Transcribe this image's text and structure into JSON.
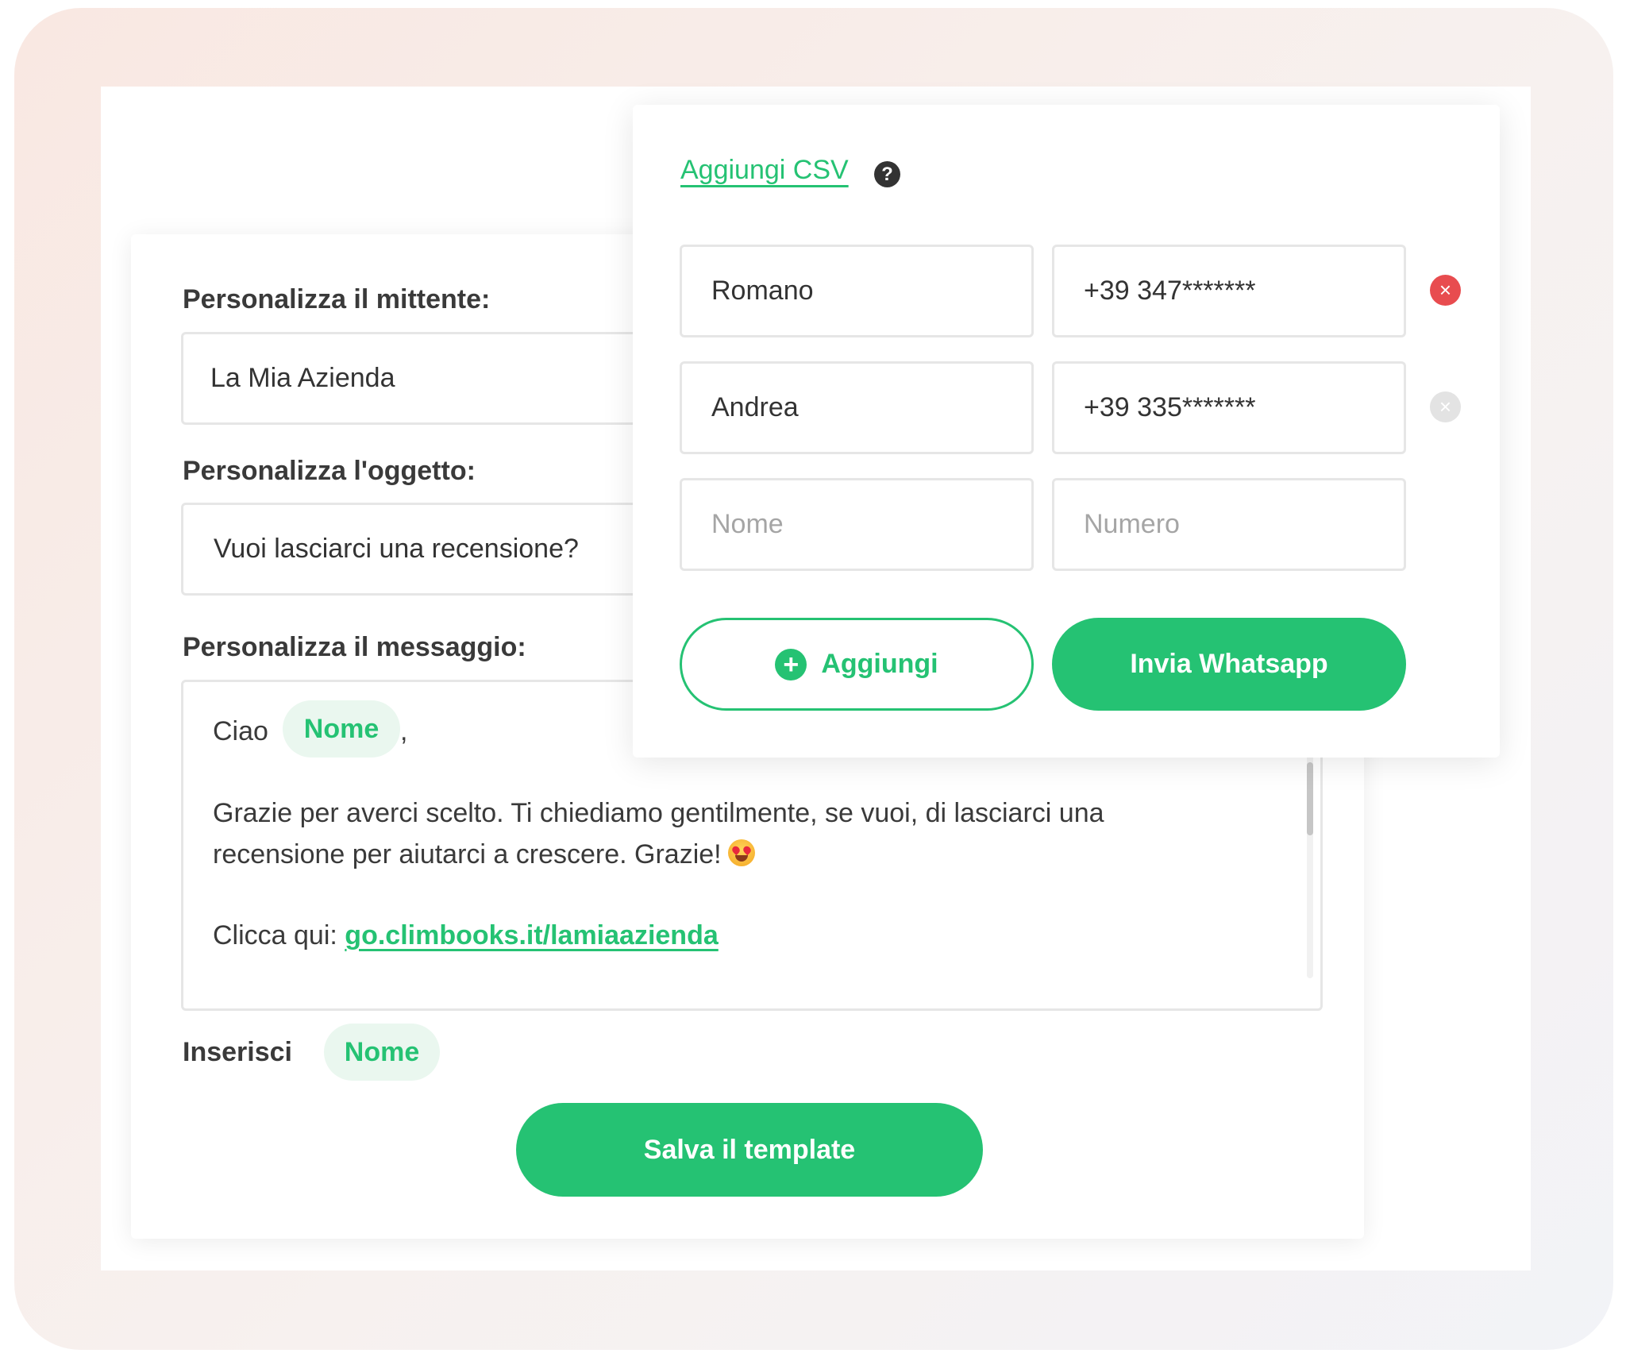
{
  "colors": {
    "accent": "#25c273",
    "chip_bg": "#eaf7ef",
    "danger": "#e84c4f",
    "disabled": "#e3e3e3"
  },
  "template_editor": {
    "sender_label": "Personalizza il mittente:",
    "sender_value": "La Mia Azienda",
    "subject_label": "Personalizza l'oggetto:",
    "subject_value": "Vuoi lasciarci una recensione?",
    "message_label": "Personalizza il messaggio:",
    "message": {
      "greeting": "Ciao",
      "name_chip": "Nome",
      "greeting_comma": ",",
      "body_line1": "Grazie per averci scelto. Ti chiediamo gentilmente, se vuoi, di lasciarci una",
      "body_line2": "recensione per aiutarci a crescere. Grazie!",
      "emoji": "heart-eyes-emoji",
      "link_prefix": "Clicca qui:",
      "link": "go.climbooks.it/lamiaazienda"
    },
    "insert_label": "Inserisci",
    "insert_chip": "Nome",
    "save_button": "Salva il template"
  },
  "recipients": {
    "csv_link": "Aggiungi CSV",
    "help_icon": "?",
    "rows": [
      {
        "name": "Romano",
        "number": "+39 347*******",
        "remove_state": "active"
      },
      {
        "name": "Andrea",
        "number": "+39 335*******",
        "remove_state": "disabled"
      }
    ],
    "new_row": {
      "name_placeholder": "Nome",
      "number_placeholder": "Numero"
    },
    "add_button": "Aggiungi",
    "send_button": "Invia Whatsapp"
  }
}
